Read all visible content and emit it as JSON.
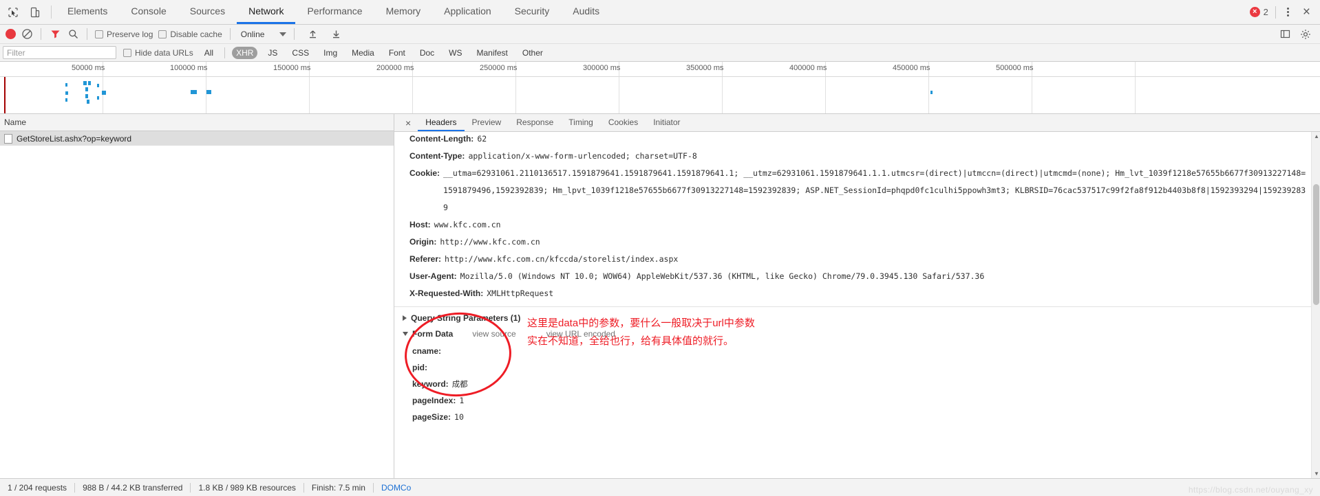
{
  "window": {
    "error_count": "2",
    "inspect_icon": "cursor-select-icon",
    "device_icon": "device-toolbar-icon",
    "more_icon": "kebab-menu-icon",
    "close_icon": "close-icon"
  },
  "tabs": [
    {
      "label": "Elements",
      "active": false
    },
    {
      "label": "Console",
      "active": false
    },
    {
      "label": "Sources",
      "active": false
    },
    {
      "label": "Network",
      "active": true
    },
    {
      "label": "Performance",
      "active": false
    },
    {
      "label": "Memory",
      "active": false
    },
    {
      "label": "Application",
      "active": false
    },
    {
      "label": "Security",
      "active": false
    },
    {
      "label": "Audits",
      "active": false
    }
  ],
  "network_toolbar": {
    "record_icon": "record-button-icon",
    "clear_icon": "clear-icon",
    "filter_icon": "filter-icon",
    "search_icon": "search-icon",
    "preserve_log_label": "Preserve log",
    "preserve_log_checked": false,
    "disable_cache_label": "Disable cache",
    "disable_cache_checked": false,
    "throttle_value": "Online",
    "import_icon": "import-har-icon",
    "export_icon": "export-har-icon",
    "settings_icon": "gear-icon",
    "sidebar_icon": "sidebar-toggle-icon"
  },
  "filter_bar": {
    "filter_placeholder": "Filter",
    "filter_value": "",
    "hide_data_urls_label": "Hide data URLs",
    "hide_data_urls_checked": false,
    "types": [
      {
        "label": "All",
        "selected": false
      },
      {
        "label": "XHR",
        "selected": true
      },
      {
        "label": "JS",
        "selected": false
      },
      {
        "label": "CSS",
        "selected": false
      },
      {
        "label": "Img",
        "selected": false
      },
      {
        "label": "Media",
        "selected": false
      },
      {
        "label": "Font",
        "selected": false
      },
      {
        "label": "Doc",
        "selected": false
      },
      {
        "label": "WS",
        "selected": false
      },
      {
        "label": "Manifest",
        "selected": false
      },
      {
        "label": "Other",
        "selected": false
      }
    ]
  },
  "overview": {
    "ticks": [
      "50000 ms",
      "100000 ms",
      "150000 ms",
      "200000 ms",
      "250000 ms",
      "300000 ms",
      "350000 ms",
      "400000 ms",
      "450000 ms",
      "500000 ms"
    ],
    "marker_color": "#2196d6",
    "redline_color": "#a30000"
  },
  "requests_panel": {
    "column_header": "Name",
    "rows": [
      {
        "name": "GetStoreList.ashx?op=keyword",
        "selected": true
      }
    ]
  },
  "detail_panel": {
    "close_label": "×",
    "tabs": [
      {
        "label": "Headers",
        "active": true
      },
      {
        "label": "Preview",
        "active": false
      },
      {
        "label": "Response",
        "active": false
      },
      {
        "label": "Timing",
        "active": false
      },
      {
        "label": "Cookies",
        "active": false
      },
      {
        "label": "Initiator",
        "active": false
      }
    ],
    "headers": [
      {
        "key": "Content-Length:",
        "value": "62"
      },
      {
        "key": "Content-Type:",
        "value": "application/x-www-form-urlencoded; charset=UTF-8"
      },
      {
        "key": "Cookie:",
        "value": "__utma=62931061.2110136517.1591879641.1591879641.1591879641.1;  __utmz=62931061.1591879641.1.1.utmcsr=(direct)|utmccn=(direct)|utmcmd=(none);  Hm_lvt_1039f1218e57655b6677f30913227148=1591879496,1592392839;  Hm_lpvt_1039f1218e57655b6677f30913227148=1592392839;  ASP.NET_SessionId=phqpd0fc1culhi5ppowh3mt3;  KLBRSID=76cac537517c99f2fa8f912b4403b8f8|1592393294|1592392839"
      },
      {
        "key": "Host:",
        "value": "www.kfc.com.cn"
      },
      {
        "key": "Origin:",
        "value": "http://www.kfc.com.cn"
      },
      {
        "key": "Referer:",
        "value": "http://www.kfc.com.cn/kfccda/storelist/index.aspx"
      },
      {
        "key": "User-Agent:",
        "value": "Mozilla/5.0 (Windows NT 10.0; WOW64) AppleWebKit/537.36 (KHTML, like Gecko) Chrome/79.0.3945.130 Safari/537.36"
      },
      {
        "key": "X-Requested-With:",
        "value": "XMLHttpRequest"
      }
    ],
    "query_string_section": {
      "title": "Query String Parameters (1)",
      "expanded": false
    },
    "form_data_section": {
      "title": "Form Data",
      "expanded": true,
      "view_source_label": "view source",
      "view_url_encoded_label": "view URL encoded",
      "params": [
        {
          "key": "cname:",
          "value": ""
        },
        {
          "key": "pid:",
          "value": ""
        },
        {
          "key": "keyword:",
          "value": "成都"
        },
        {
          "key": "pageIndex:",
          "value": "1"
        },
        {
          "key": "pageSize:",
          "value": "10"
        }
      ]
    }
  },
  "annotation": {
    "color": "#ee1c25",
    "line1": "这里是data中的参数，要什么一般取决于url中参数",
    "line2": "实在不知道，全给也行，给有具体值的就行。"
  },
  "status_bar": {
    "requests": "1 / 204 requests",
    "transferred": "988 B / 44.2 KB transferred",
    "resources": "1.8 KB / 989 KB resources",
    "finish": "Finish: 7.5 min",
    "domcontentloaded": "DOMCo",
    "watermark": "https://blog.csdn.net/ouyang_xy"
  }
}
